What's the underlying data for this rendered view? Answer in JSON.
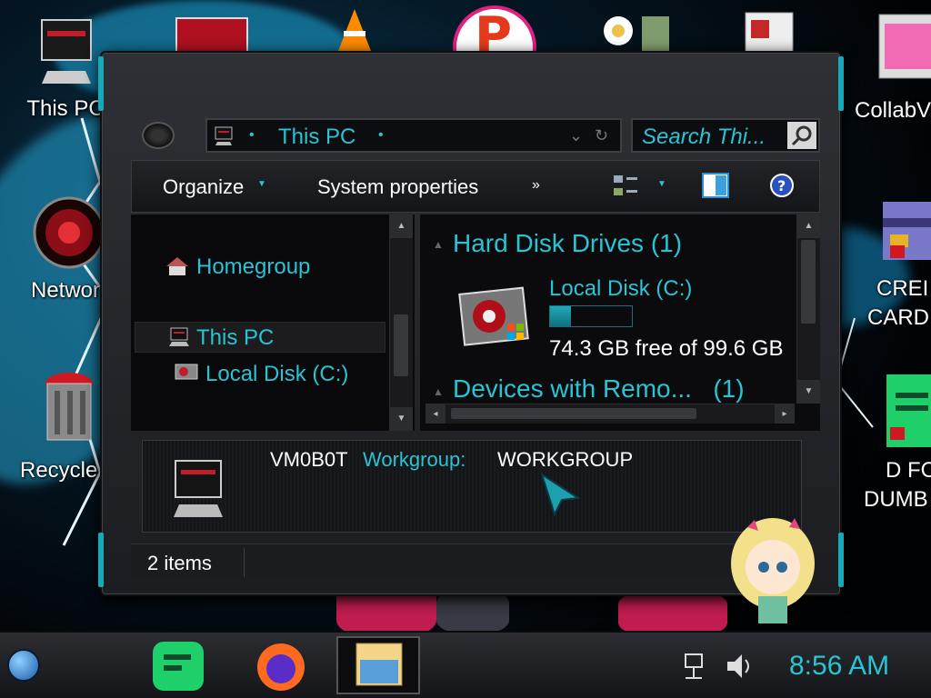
{
  "desktop": {
    "icons": [
      {
        "label": "This PC",
        "id": "this-pc"
      },
      {
        "label": "Networ",
        "id": "network"
      },
      {
        "label": "Recycle E",
        "id": "recycle-bin"
      },
      {
        "label": "CollabV",
        "id": "collabv"
      },
      {
        "label": "CREI",
        "id": "credit-card-1"
      },
      {
        "label": "CARD",
        "id": "credit-card-2"
      },
      {
        "label": "D FO",
        "id": "d-fo-1"
      },
      {
        "label": "DUMB",
        "id": "d-fo-2"
      }
    ]
  },
  "window": {
    "address": {
      "location": "This PC",
      "sep": "•"
    },
    "search": {
      "placeholder": "Search Thi..."
    },
    "toolbar": {
      "organize_label": "Organize",
      "system_properties_label": "System properties",
      "more_label": "»"
    },
    "nav": {
      "items": [
        {
          "label": "Homegroup"
        },
        {
          "label": "This PC"
        },
        {
          "label": "Local Disk (C:)"
        }
      ]
    },
    "content": {
      "groups": [
        {
          "title": "Hard Disk Drives",
          "count": "(1)"
        },
        {
          "title": "Devices with Remo...",
          "count": "(1)"
        }
      ],
      "drive": {
        "name": "Local Disk (C:)",
        "free_text": "74.3 GB free of 99.6 GB",
        "used_fraction": 0.254
      }
    },
    "details": {
      "computer_name": "VM0B0T",
      "workgroup_label": "Workgroup:",
      "workgroup_value": "WORKGROUP"
    },
    "status": {
      "items_text": "2 items"
    }
  },
  "taskbar": {
    "clock": "8:56 AM"
  },
  "colors": {
    "accent": "#29c4d4",
    "window_bg": "#1c1d21"
  }
}
